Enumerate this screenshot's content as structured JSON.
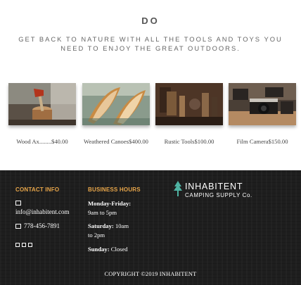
{
  "intro": {
    "title": "DO",
    "subtitle_line1": "GET BACK TO NATURE WITH ALL THE TOOLS AND TOYS YOU",
    "subtitle_line2": "NEED TO ENJOY THE GREAT OUTDOORS."
  },
  "products": [
    {
      "name": "Wood Ax........",
      "price": "$40.00",
      "image": "axe-in-stump"
    },
    {
      "name": "Weathered Canoes",
      "price": "$400.00",
      "image": "canoes"
    },
    {
      "name": "Rustic Tools",
      "price": "$100.00",
      "image": "rustic-tools"
    },
    {
      "name": "Film Camera",
      "price": "$150.00",
      "image": "film-cameras"
    }
  ],
  "footer": {
    "contact": {
      "heading": "CONTACT INFO",
      "email": "info@inhabitent.com",
      "phone": "778-456-7891",
      "email_icon": "envelope-icon",
      "phone_icon": "phone-square-icon",
      "social_icons": [
        "facebook-icon",
        "instagram-icon",
        "twitter-icon"
      ]
    },
    "hours": {
      "heading": "BUSINESS HOURS",
      "mon_fri_label": "Monday-Friday:",
      "mon_fri_time": "9am to 5pm",
      "sat_label": "Saturday:",
      "sat_time_1": "10am",
      "sat_time_2": "to 2pm",
      "sun_label": "Sunday:",
      "sun_time": "Closed"
    },
    "logo": {
      "name": "INHABITENT",
      "tagline": "CAMPING SUPPLY Co."
    },
    "copyright": "COPYRIGHT ©2019 INHABITENT"
  },
  "colors": {
    "heading_accent": "#e8a64a",
    "logo_tree": "#4fb3a3",
    "footer_bg": "#1e1e1e"
  }
}
